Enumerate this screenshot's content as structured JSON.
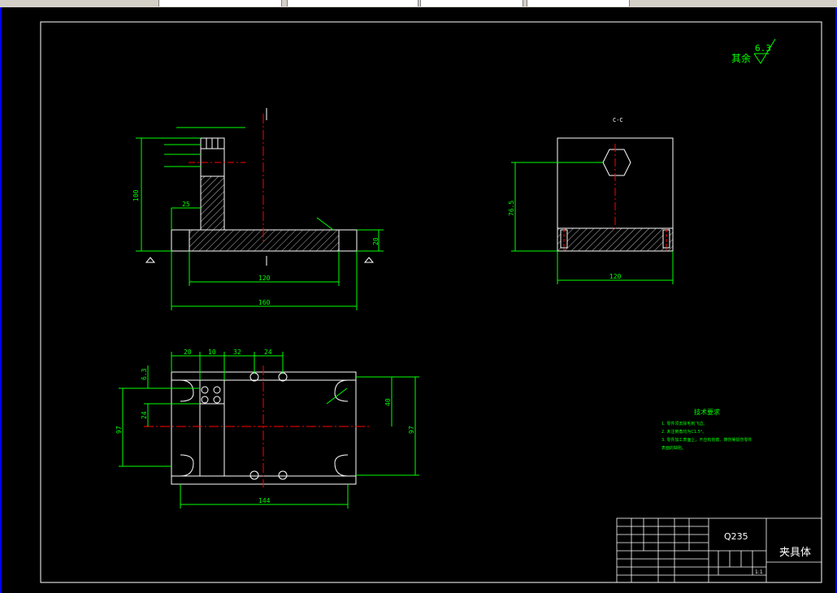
{
  "drawing": {
    "roughness_label": "其余",
    "roughness_value": "6.3",
    "section_label": "C-C",
    "dimensions": {
      "front_height_total": "100",
      "front_base_height": "20",
      "front_inner_width": "120",
      "front_outer_width": "160",
      "front_left_offset": "25",
      "side_height": "76.5",
      "side_width": "120",
      "plan_d1": "20",
      "plan_d2": "10",
      "plan_d3": "32",
      "plan_d4": "24",
      "plan_h_left": "97",
      "plan_h_right": "97",
      "plan_h_mid": "40",
      "plan_h_small": "24",
      "plan_width": "144",
      "plan_h_top": "6.3"
    },
    "tech_requirements": {
      "title": "技术要求",
      "items": [
        "1. 零件须去除毛刺飞边。",
        "2. 未注倒角均为C1.5°。",
        "3. 零件加工表面上，不应有划痕、擦伤等损伤零件",
        "表面的缺陷。"
      ]
    },
    "title_block": {
      "material": "Q235",
      "part_name": "夹具体",
      "scale": "1:1"
    }
  }
}
